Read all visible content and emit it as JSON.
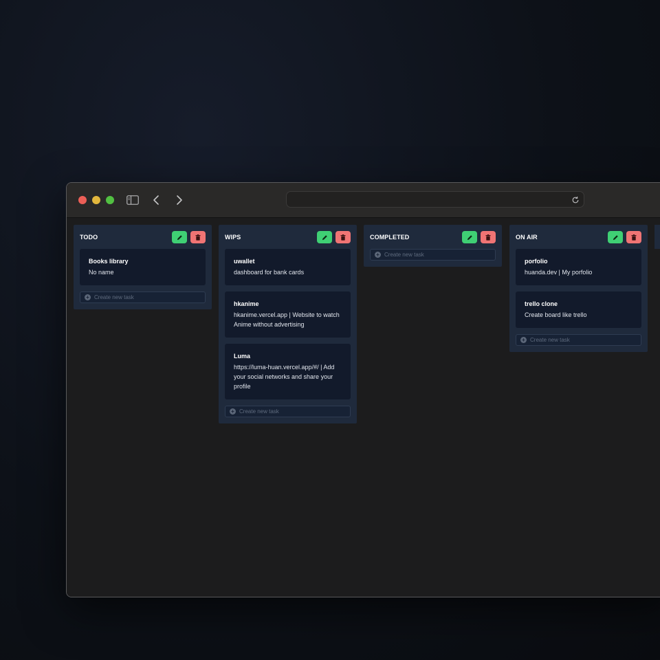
{
  "browser": {
    "traffic_lights": {
      "close": "#ec5f57",
      "minimize": "#e3b73d",
      "maximize": "#52c042"
    },
    "address": ""
  },
  "colors": {
    "column_bg": "#1f2a3c",
    "card_bg": "#121a2b",
    "edit_button": "#3fcf74",
    "delete_button": "#f07474"
  },
  "icons": {
    "sidebar": "sidebar-icon",
    "back": "chevron-left-icon",
    "forward": "chevron-right-icon",
    "reload": "reload-icon",
    "edit": "pencil-icon",
    "delete": "trash-icon",
    "add": "plus-circle-icon"
  },
  "columns": [
    {
      "title": "TODO",
      "cards": [
        {
          "title": "Books library",
          "desc": "No name"
        }
      ],
      "new_task_placeholder": "Create new task"
    },
    {
      "title": "WIPS",
      "cards": [
        {
          "title": "uwallet",
          "desc": "dashboard for bank cards"
        },
        {
          "title": "hkanime",
          "desc": "hkanime.vercel.app | Website to watch Anime without advertising"
        },
        {
          "title": "Luma",
          "desc": "https://luma-huan.vercel.app/#/ | Add your social networks and share your profile"
        }
      ],
      "new_task_placeholder": "Create new task"
    },
    {
      "title": "COMPLETED",
      "cards": [],
      "new_task_placeholder": "Create new task"
    },
    {
      "title": "ON AIR",
      "cards": [
        {
          "title": "porfolio",
          "desc": "huanda.dev | My porfolio"
        },
        {
          "title": "trello clone",
          "desc": "Create board like trello"
        }
      ],
      "new_task_placeholder": "Create new task"
    }
  ]
}
